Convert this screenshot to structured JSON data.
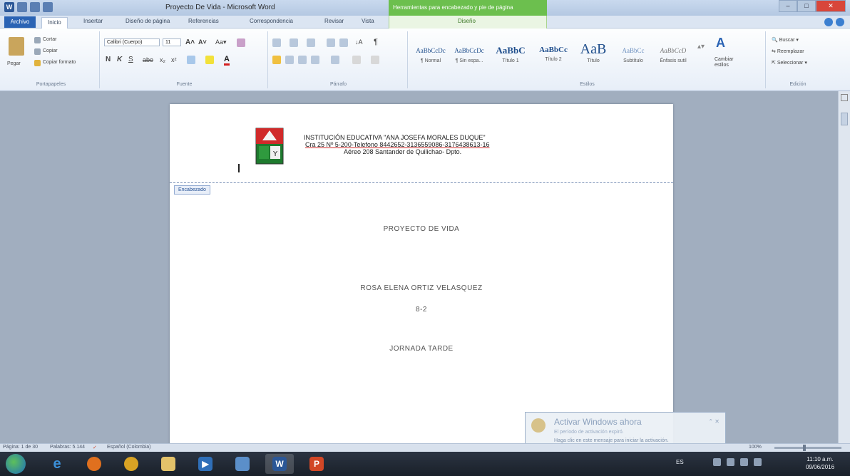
{
  "window": {
    "title": "Proyecto De Vida - Microsoft Word",
    "contextual_tab_title": "Herramientas para encabezado y pie de página",
    "contextual_tab_label": "Diseño"
  },
  "tabs": [
    "Archivo",
    "Inicio",
    "Insertar",
    "Diseño de página",
    "Referencias",
    "Correspondencia",
    "Revisar",
    "Vista"
  ],
  "ribbon": {
    "clipboard": {
      "paste": "Pegar",
      "cut": "Cortar",
      "copy": "Copiar",
      "format_painter": "Copiar formato",
      "label": "Portapapeles"
    },
    "font": {
      "font_name": "Calibri (Cuerpo)",
      "font_size": "11",
      "label": "Fuente"
    },
    "paragraph": {
      "label": "Párrafo"
    },
    "styles": {
      "label": "Estilos",
      "items": [
        {
          "sample": "AaBbCcDc",
          "name": "¶ Normal"
        },
        {
          "sample": "AaBbCcDc",
          "name": "¶ Sin espa..."
        },
        {
          "sample": "AaBbC",
          "name": "Título 1"
        },
        {
          "sample": "AaBbCc",
          "name": "Título 2"
        },
        {
          "sample": "AaB",
          "name": "Título"
        },
        {
          "sample": "AaBbCc",
          "name": "Subtítulo"
        },
        {
          "sample": "AaBbCcD",
          "name": "Énfasis sutil"
        }
      ],
      "change_styles": "Cambiar estilos"
    },
    "editing": {
      "label": "Edición",
      "find": "Buscar",
      "replace": "Reemplazar",
      "select": "Seleccionar"
    }
  },
  "document": {
    "header_line1": "INSTITUCIÓN  EDUCATIVA \"ANA JOSEFA MORALES DUQUE\"",
    "header_line2": "Cra 25 Nº 5-200-Telefono  8442652-3136559086-3176438613-16",
    "header_line3": "Aéreo 208 Santander  de Quilichao- Dpto.",
    "header_tag": "Encabezado",
    "line_title": "PROYECTO DE  VIDA",
    "line_name": "ROSA ELENA ORTIZ VELASQUEZ",
    "line_grade": "8-2",
    "line_shift": "JORNADA TARDE"
  },
  "toast": {
    "title": "Activar Windows ahora",
    "line1": "El período de activación expiró.",
    "line2": "Haga clic en este mensaje para iniciar la activación."
  },
  "status": {
    "page": "Página: 1 de 30",
    "words": "Palabras: 5.144",
    "language": "Español (Colombia)",
    "zoom": "100%"
  },
  "taskbar": {
    "language": "ES",
    "time": "11:10 a.m.",
    "date": "09/06/2016"
  },
  "colors": {
    "file_tab": "#2a63b4",
    "contextual_tab": "#6cbf4e",
    "taskbar": "#1a2029"
  }
}
